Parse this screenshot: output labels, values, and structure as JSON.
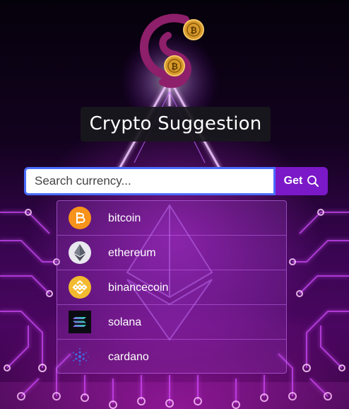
{
  "brand": {
    "logo_letter": "S",
    "coin_mark": "₿"
  },
  "header": {
    "title": "Crypto Suggestion"
  },
  "search": {
    "placeholder": "Search currency...",
    "value": "",
    "button_label": "Get",
    "button_icon": "search-icon"
  },
  "suggestions": [
    {
      "label": "bitcoin",
      "icon": "bitcoin-icon",
      "color": "#f7931a"
    },
    {
      "label": "ethereum",
      "icon": "ethereum-icon",
      "color": "#8a8f98"
    },
    {
      "label": "binancecoin",
      "icon": "binancecoin-icon",
      "color": "#f3ba2f"
    },
    {
      "label": "solana",
      "icon": "solana-icon",
      "color": "#14f195"
    },
    {
      "label": "cardano",
      "icon": "cardano-icon",
      "color": "#2a5fd6"
    }
  ],
  "colors": {
    "accent": "#7b18c8",
    "input_border": "#4a6cff",
    "title_bg": "#18181c"
  }
}
